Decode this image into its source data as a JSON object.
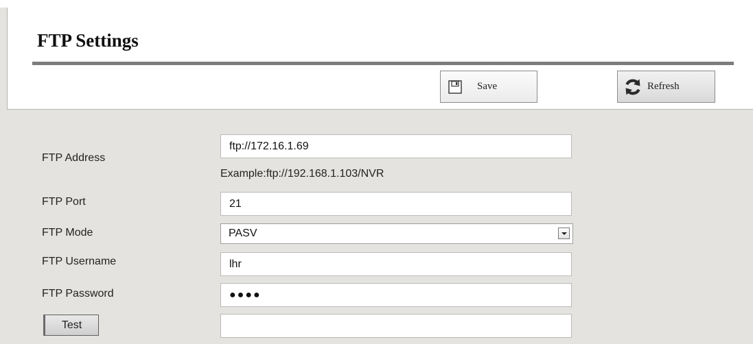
{
  "top_strip": {
    "text": ""
  },
  "header": {
    "title": "FTP Settings",
    "save_label": "Save",
    "save_icon": "save-icon",
    "refresh_label": "Refresh",
    "refresh_icon": "refresh-icon"
  },
  "form": {
    "address": {
      "label": "FTP Address",
      "value": "ftp://172.16.1.69",
      "hint": "Example:ftp://192.168.1.103/NVR"
    },
    "port": {
      "label": "FTP Port",
      "value": "21"
    },
    "mode": {
      "label": "FTP Mode",
      "value": "PASV",
      "icon": "dropdown-arrow-icon"
    },
    "username": {
      "label": "FTP Username",
      "value": "lhr"
    },
    "password": {
      "label": "FTP Password",
      "value": "●●●●"
    },
    "test": {
      "label": "Test",
      "result": ""
    }
  },
  "colors": {
    "background": "#e5e3df",
    "panel": "#ffffff",
    "rule": "#7d7d7d"
  }
}
